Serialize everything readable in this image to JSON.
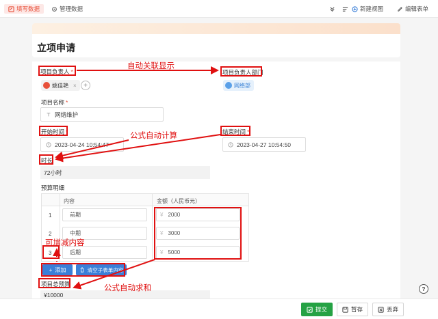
{
  "topbar": {
    "tab_fill": "填写数据",
    "tab_manage": "管理数据",
    "new_view": "新建视图",
    "edit_form": "编辑表单"
  },
  "form": {
    "title": "立项申请",
    "owner": {
      "label": "项目负责人",
      "required": "*",
      "user": "姚佳艳",
      "remove": "×"
    },
    "dept": {
      "label": "项目负责人部门",
      "value": "网络部"
    },
    "name": {
      "label": "项目名称",
      "required": "*",
      "value": "网络维护"
    },
    "start": {
      "label": "开始时间",
      "required": "*",
      "value": "2023-04-24 10:54:47"
    },
    "end": {
      "label": "结束时间",
      "required": "*",
      "value": "2023-04-27 10:54:50"
    },
    "duration": {
      "label": "时长",
      "value": "72小时"
    },
    "budget": {
      "label": "预算明细",
      "col_content": "内容",
      "col_amount": "金额（人民币元）",
      "currency": "¥",
      "rows": [
        {
          "no": "1",
          "content": "前期",
          "amount": "2000"
        },
        {
          "no": "2",
          "content": "中期",
          "amount": "3000"
        },
        {
          "no": "3",
          "content": "后期",
          "amount": "5000"
        }
      ],
      "add_label": "添加",
      "clear_label": "清空子表单内容"
    },
    "total": {
      "label": "项目总预算",
      "value": "¥10000"
    }
  },
  "annotations": {
    "auto_link": "自动关联显示",
    "formula_calc": "公式自动计算",
    "add_remove": "可增减内容",
    "formula_sum": "公式自动求和"
  },
  "actions": {
    "submit": "提交",
    "draft": "暂存",
    "discard": "丢弃"
  },
  "colors": {
    "accent": "#e8503a",
    "annotation": "#e01010",
    "submit": "#25a244",
    "blue": "#3a7fd8"
  }
}
